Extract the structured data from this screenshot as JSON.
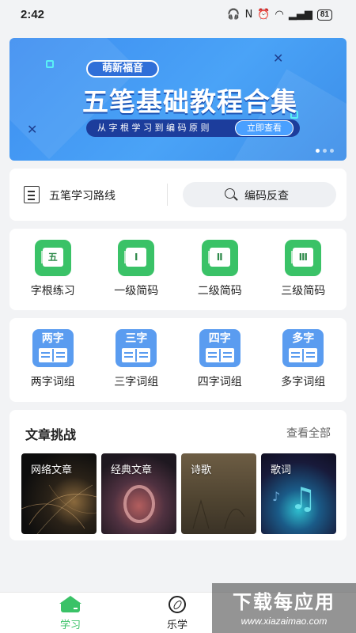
{
  "status_bar": {
    "time": "2:42",
    "battery": "81"
  },
  "banner": {
    "tag": "萌新福音",
    "headline": "五笔基础教程合集",
    "subline": "从 字 根 学 习 到 编 码 原 则",
    "cta": "立即查看",
    "pages": 3,
    "current_page": 1,
    "colors": {
      "bg": "#4aa3f7",
      "accent": "#59f0f5"
    }
  },
  "route_card": {
    "label": "五笔学习路线",
    "search_label": "编码反查"
  },
  "practice": {
    "items": [
      {
        "label": "字根练习",
        "glyph": "五"
      },
      {
        "label": "一级简码",
        "glyph": "Ⅰ"
      },
      {
        "label": "二级简码",
        "glyph": "Ⅱ"
      },
      {
        "label": "三级简码",
        "glyph": "Ⅲ"
      }
    ],
    "icon_color": "#3ac267"
  },
  "phrases": {
    "items": [
      {
        "label": "两字词组",
        "glyph": "两字"
      },
      {
        "label": "三字词组",
        "glyph": "三字"
      },
      {
        "label": "四字词组",
        "glyph": "四字"
      },
      {
        "label": "多字词组",
        "glyph": "多字"
      }
    ],
    "icon_color": "#5a9cf0"
  },
  "articles": {
    "title": "文章挑战",
    "more": "查看全部",
    "tiles": [
      {
        "label": "网络文章"
      },
      {
        "label": "经典文章"
      },
      {
        "label": "诗歌"
      },
      {
        "label": "歌词"
      }
    ]
  },
  "tabbar": {
    "tabs": [
      {
        "label": "学习",
        "active": true
      },
      {
        "label": "乐学",
        "active": false
      }
    ],
    "active_color": "#3ac267"
  },
  "watermark": {
    "title": "下载每应用",
    "url": "www.xiazaimao.com"
  }
}
